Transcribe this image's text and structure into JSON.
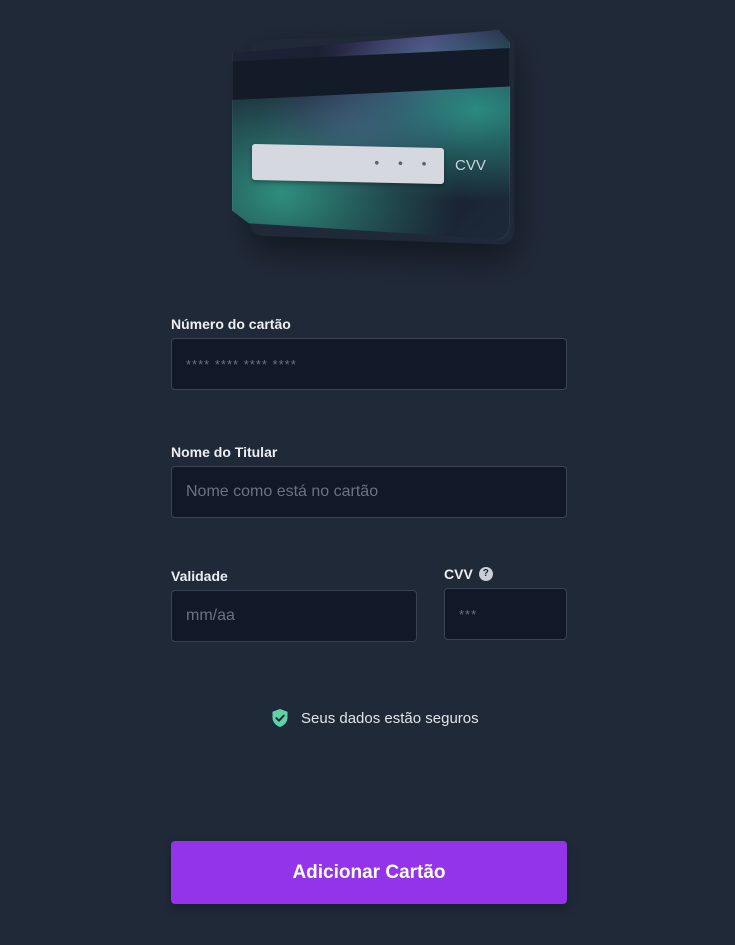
{
  "card_preview": {
    "cvv_tag": "CVV",
    "signature_dots": "• • •"
  },
  "form": {
    "card_number": {
      "label": "Número do cartão",
      "placeholder": "**** **** **** ****",
      "value": ""
    },
    "holder_name": {
      "label": "Nome do Titular",
      "placeholder": "Nome como está no cartão",
      "value": ""
    },
    "expiry": {
      "label": "Validade",
      "placeholder": "mm/aa",
      "value": ""
    },
    "cvv": {
      "label": "CVV",
      "help_icon": "?",
      "placeholder": "***",
      "value": ""
    }
  },
  "secure_notice": {
    "icon": "shield-check-icon",
    "text": "Seus dados estão seguros",
    "icon_color": "#5fd3a8"
  },
  "submit": {
    "label": "Adicionar Cartão",
    "color": "#9333ea"
  }
}
